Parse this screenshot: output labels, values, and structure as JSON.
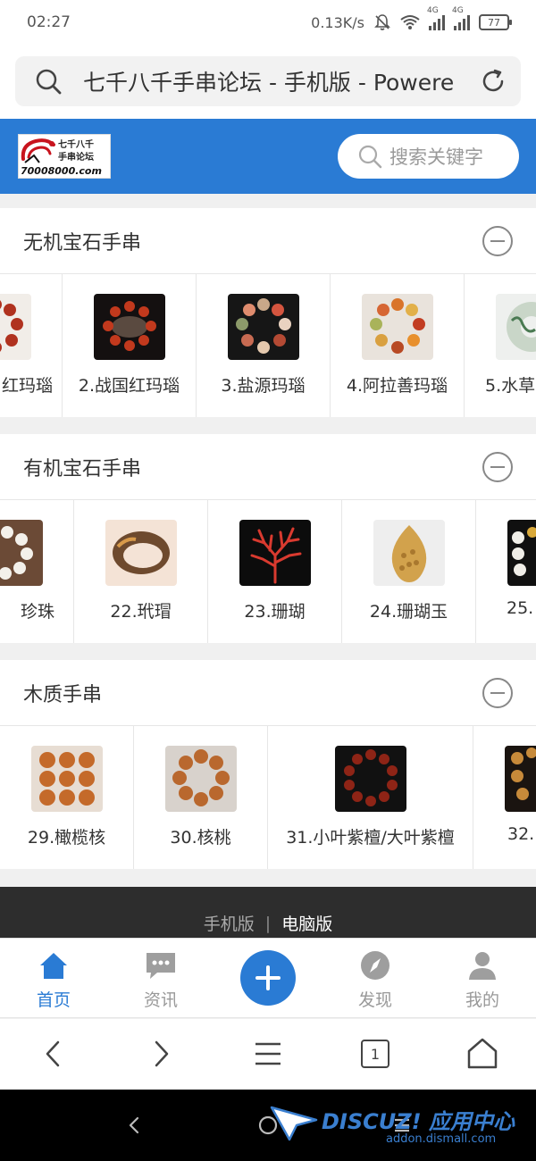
{
  "status_bar": {
    "time": "02:27",
    "speed": "0.13K/s",
    "net_badge_1": "4G",
    "net_badge_2": "4G",
    "battery": "77"
  },
  "url_bar": {
    "title": "七千八千手串论坛 - 手机版 - Powere"
  },
  "header": {
    "logo_line1": "七千八千",
    "logo_line2": "手串论坛",
    "logo_domain": "70008000.com",
    "search_placeholder": "搜索关键字"
  },
  "sections": [
    {
      "title": "无机宝石手串",
      "items": [
        {
          "label": "红玛瑙",
          "image": "red-agate-bracelet"
        },
        {
          "label": "2.战国红玛瑙",
          "image": "zhanguo-red-agate-bracelet"
        },
        {
          "label": "3.盐源玛瑙",
          "image": "yanyuan-agate-bracelet"
        },
        {
          "label": "4.阿拉善玛瑙",
          "image": "alxa-agate-bracelet"
        },
        {
          "label": "5.水草",
          "image": "moss-agate-bracelet"
        }
      ]
    },
    {
      "title": "有机宝石手串",
      "items": [
        {
          "label": "珍珠",
          "image": "pearl-bracelet"
        },
        {
          "label": "22.玳瑁",
          "image": "tortoiseshell-bangle"
        },
        {
          "label": "23.珊瑚",
          "image": "red-coral-branch"
        },
        {
          "label": "24.珊瑚玉",
          "image": "coral-jade-pendant"
        },
        {
          "label": "25.",
          "image": "pearl-strand"
        }
      ]
    },
    {
      "title": "木质手串",
      "items": [
        {
          "label": "29.橄榄核",
          "image": "olive-pit-carving"
        },
        {
          "label": "30.核桃",
          "image": "walnut-bracelet"
        },
        {
          "label": "31.小叶紫檀/大叶紫檀",
          "image": "red-sandalwood-bracelet"
        },
        {
          "label": "32.",
          "image": "wood-bead-bracelet"
        }
      ]
    }
  ],
  "footer": {
    "mobile": "手机版",
    "separator": "|",
    "pc": "电脑版"
  },
  "tabs": [
    {
      "label": "首页",
      "icon": "home-icon",
      "active": true
    },
    {
      "label": "资讯",
      "icon": "chat-icon",
      "active": false
    },
    {
      "label": "",
      "icon": "plus-icon",
      "active": false
    },
    {
      "label": "发现",
      "icon": "compass-icon",
      "active": false
    },
    {
      "label": "我的",
      "icon": "user-icon",
      "active": false
    }
  ],
  "browser_nav": {
    "tab_count": "1"
  },
  "watermark": {
    "main": "DISCUZ! 应用中心",
    "sub": "addon.dismall.com"
  },
  "colors": {
    "brand_blue": "#2a7bd4",
    "footer_bg": "#2d2d2d",
    "inactive_tab": "#999999"
  }
}
